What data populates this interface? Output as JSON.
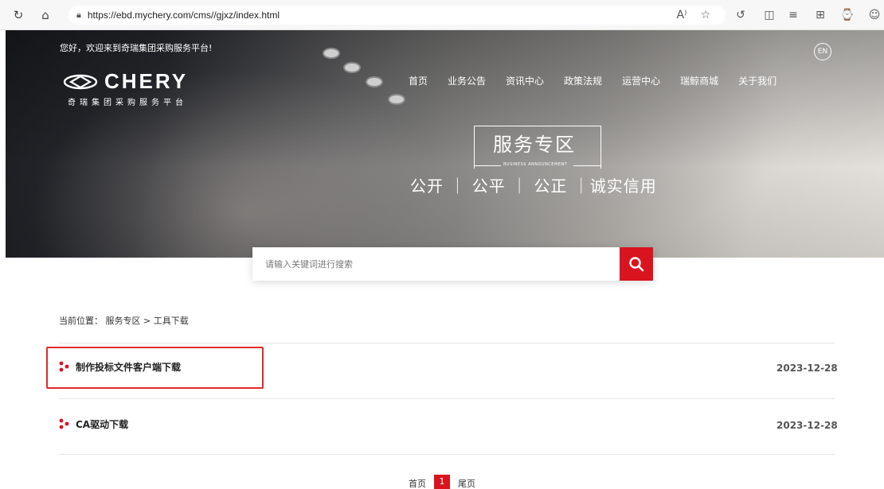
{
  "browser": {
    "url": "https://ebd.mychery.com/cms//gjxz/index.html",
    "read_aloud": "A̅"
  },
  "header": {
    "greeting": "您好，欢迎来到奇瑞集团采购服务平台!",
    "lang_button": "EN",
    "logo_text": "CHERY",
    "logo_sub": "奇瑞集团采购服务平台",
    "nav": [
      "首页",
      "业务公告",
      "资讯中心",
      "政策法规",
      "运营中心",
      "瑞鲸商城",
      "关于我们"
    ]
  },
  "hero": {
    "title": "服务专区",
    "subtitle": "BUSINESS ANNOUNCEMENT",
    "slogan": "公开 ｜ 公平 ｜ 公正 ｜诚实信用"
  },
  "search": {
    "placeholder": "请输入关键词进行搜索"
  },
  "breadcrumb": "当前位置： 服务专区 > 工具下载",
  "list": [
    {
      "title": "制作投标文件客户端下载",
      "date": "2023-12-28"
    },
    {
      "title": "CA驱动下载",
      "date": "2023-12-28"
    }
  ],
  "pagination": {
    "first": "首页",
    "current": "1",
    "last": "尾页"
  },
  "colors": {
    "accent": "#d9141f",
    "highlight": "#e02b2b"
  }
}
